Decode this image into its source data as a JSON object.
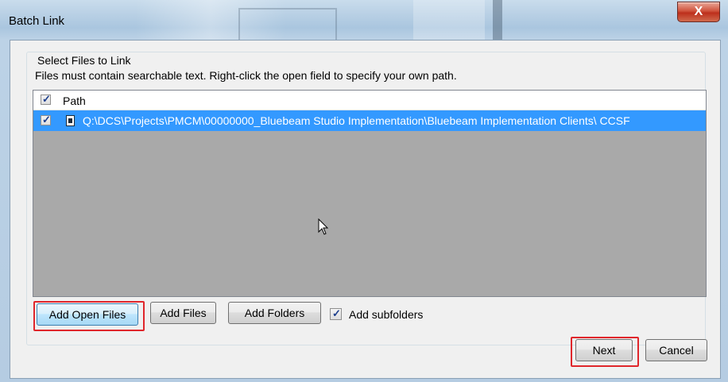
{
  "window": {
    "title": "Batch Link",
    "close_label": "X"
  },
  "group": {
    "label": "Select Files to Link",
    "description": "Files must contain searchable text. Right-click the open field to specify your own path."
  },
  "file_list": {
    "header": {
      "checked": true,
      "column_label": "Path"
    },
    "rows": [
      {
        "checked": true,
        "icon": "pdf-file-icon",
        "path": "Q:\\DCS\\Projects\\PMCM\\00000000_Bluebeam Studio Implementation\\Bluebeam Implementation Clients\\ CCSF",
        "selected": true
      }
    ]
  },
  "buttons": {
    "add_open_files": "Add Open Files",
    "add_files": "Add Files",
    "add_folders": "Add Folders",
    "next": "Next",
    "cancel": "Cancel"
  },
  "options": {
    "add_subfolders_label": "Add subfolders",
    "add_subfolders_checked": true
  },
  "colors": {
    "selection": "#3399ff",
    "list_background": "#a9a9a9",
    "highlight": "#e0262b"
  }
}
